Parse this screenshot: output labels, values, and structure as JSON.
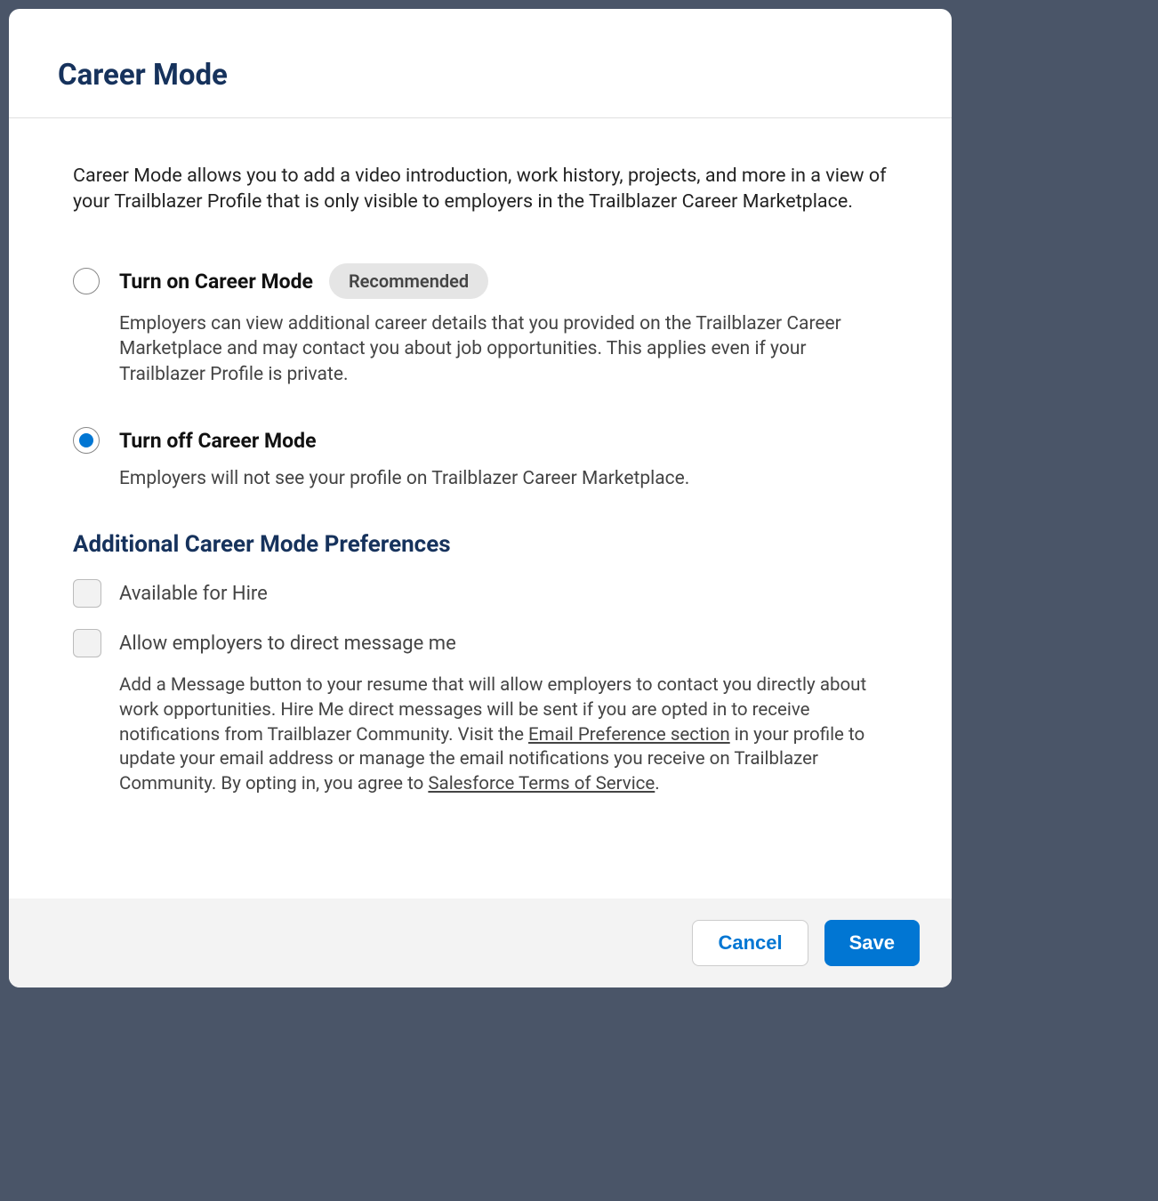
{
  "header": {
    "title": "Career Mode"
  },
  "intro": "Career Mode allows you to add a video introduction, work history, projects, and more in a view of your Trailblazer Profile that is only visible to employers in the Trailblazer Career Marketplace.",
  "options": {
    "on": {
      "label": "Turn on Career Mode",
      "badge": "Recommended",
      "desc": "Employers can view additional career details that you provided on the Trailblazer Career Marketplace and may contact you about job opportunities. This applies even if your Trailblazer Profile is private.",
      "selected": false
    },
    "off": {
      "label": "Turn off Career Mode",
      "desc": "Employers will not see your profile on Trailblazer Career Marketplace.",
      "selected": true
    }
  },
  "preferences": {
    "title": "Additional Career Mode Preferences",
    "available": {
      "label": "Available for Hire",
      "checked": false
    },
    "messaging": {
      "label": "Allow employers to direct message me",
      "checked": false,
      "desc_part1": "Add a Message button to your resume that will allow employers to contact you directly about work opportunities. Hire Me direct messages will be sent if you are opted in to receive notifications from Trailblazer Community. Visit the ",
      "link1": "Email Preference section",
      "desc_part2": " in your profile to update your email address or manage the email notifications you receive on Trailblazer Community. By opting in, you agree to ",
      "link2": "Salesforce Terms of Service",
      "desc_part3": "."
    }
  },
  "footer": {
    "cancel": "Cancel",
    "save": "Save"
  }
}
